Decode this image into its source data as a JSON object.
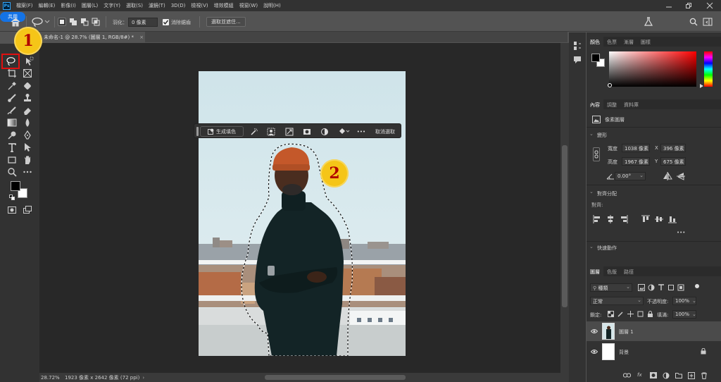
{
  "menubar": {
    "logo": "Ps",
    "items": [
      "檔案(F)",
      "編輯(E)",
      "影像(I)",
      "圖層(L)",
      "文字(Y)",
      "選取(S)",
      "濾鏡(T)",
      "3D(D)",
      "檢視(V)",
      "增效模組",
      "視窗(W)",
      "說明(H)"
    ]
  },
  "options": {
    "feather_label": "羽化：",
    "feather_value": "0 像素",
    "antialias_label": "消除鋸齒",
    "select_mask_label": "選取並遮住...",
    "share_label": "共用"
  },
  "document": {
    "tab_title": "未命名-1 @ 28.7% (圖層 1, RGB/8#) *",
    "close_glyph": "×"
  },
  "status": {
    "zoom": "28.72%",
    "doc_info": "1923 像素 x 2642 像素 (72 ppi)"
  },
  "context_bar": {
    "generative_fill_label": "生成填色",
    "more_glyph": "•••",
    "deselect_label": "取消選取"
  },
  "badges": {
    "one": "1",
    "two": "2"
  },
  "color_panel": {
    "tabs": [
      "顏色",
      "色票",
      "漸層",
      "圖樣"
    ]
  },
  "properties_panel": {
    "tabs": [
      "內容",
      "調整",
      "資料庫"
    ],
    "layer_type": "像素圖層",
    "transform_header": "變形",
    "width_label": "寬度",
    "width_value": "1038 像素",
    "x_label": "X",
    "x_value": "396 像素",
    "height_label": "高度",
    "height_value": "1967 像素",
    "y_label": "Y",
    "y_value": "675 像素",
    "angle_value": "0.00°",
    "align_header": "對齊分配",
    "align_sub": "對齊:",
    "more_glyph": "•••",
    "quick_actions_header": "快速動作"
  },
  "layers_panel": {
    "tabs": [
      "圖層",
      "色版",
      "路徑"
    ],
    "filter_label": "種類",
    "blend_mode": "正常",
    "opacity_label": "不透明度:",
    "opacity_value": "100%",
    "lock_label": "鎖定:",
    "fill_label": "填滿:",
    "fill_value": "100%",
    "layers": [
      {
        "name": "圖層 1"
      },
      {
        "name": "背景"
      }
    ]
  },
  "colors": {
    "accent": "#1473e6",
    "highlight_red": "#e01010",
    "badge_yellow": "#f5c518"
  }
}
